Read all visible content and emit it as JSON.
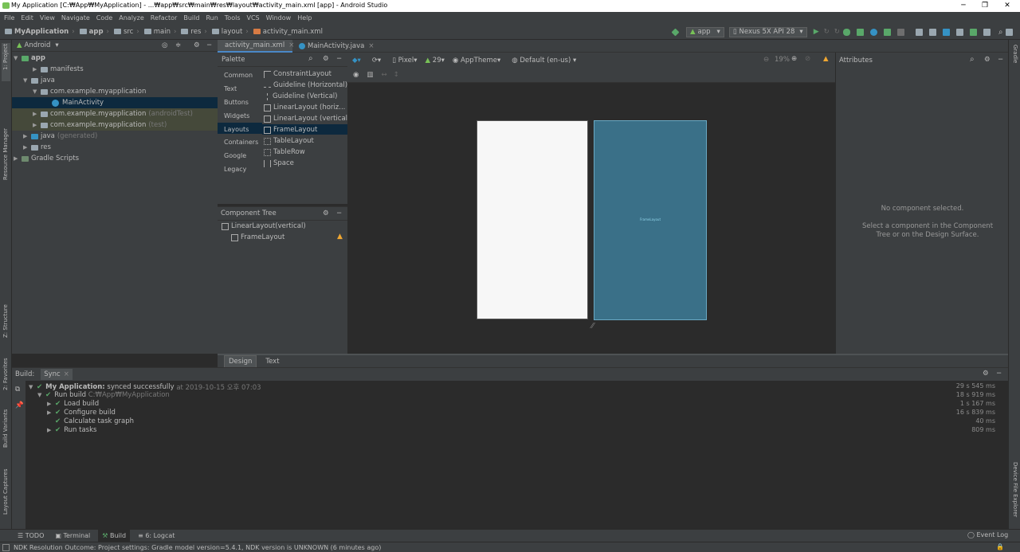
{
  "window": {
    "title": "My Application [C:₩App₩MyApplication] - ...₩app₩src₩main₩res₩layout₩activity_main.xml [app] - Android Studio"
  },
  "menu": [
    "File",
    "Edit",
    "View",
    "Navigate",
    "Code",
    "Analyze",
    "Refactor",
    "Build",
    "Run",
    "Tools",
    "VCS",
    "Window",
    "Help"
  ],
  "breadcrumb": [
    "MyApplication",
    "app",
    "src",
    "main",
    "res",
    "layout",
    "activity_main.xml"
  ],
  "toolbar": {
    "run_config": "app",
    "device": "Nexus 5X API 28"
  },
  "left_tools": {
    "project": "1: Project",
    "resource": "Resource Manager",
    "structure": "Z: Structure",
    "favorites": "2: Favorites",
    "variants": "Build Variants",
    "captures": "Layout Captures"
  },
  "right_tools": {
    "gradle": "Gradle",
    "explorer": "Device File Explorer"
  },
  "project": {
    "view": "Android",
    "tree": [
      {
        "label": "app",
        "extra": ""
      },
      {
        "label": "manifests",
        "extra": ""
      },
      {
        "label": "java",
        "extra": ""
      },
      {
        "label": "com.example.myapplication",
        "extra": ""
      },
      {
        "label": "MainActivity",
        "extra": ""
      },
      {
        "label": "com.example.myapplication",
        "extra": "(androidTest)"
      },
      {
        "label": "com.example.myapplication",
        "extra": "(test)"
      },
      {
        "label": "java",
        "extra": "(generated)"
      },
      {
        "label": "res",
        "extra": ""
      },
      {
        "label": "Gradle Scripts",
        "extra": ""
      }
    ]
  },
  "tabs": [
    "activity_main.xml",
    "MainActivity.java"
  ],
  "palette": {
    "title": "Palette",
    "categories": [
      "Common",
      "Text",
      "Buttons",
      "Widgets",
      "Layouts",
      "Containers",
      "Google",
      "Legacy"
    ],
    "items": [
      "ConstraintLayout",
      "Guideline (Horizontal)",
      "Guideline (Vertical)",
      "LinearLayout (horiz...",
      "LinearLayout (vertical)",
      "FrameLayout",
      "TableLayout",
      "TableRow",
      "Space"
    ]
  },
  "design_toolbar": {
    "device": "Pixel",
    "api": "29",
    "theme": "AppTheme",
    "locale": "Default (en-us)",
    "zoom": "19%"
  },
  "component_tree": {
    "title": "Component Tree",
    "root": "LinearLayout(vertical)",
    "child": "FrameLayout"
  },
  "blueprint": {
    "label": "FrameLayout"
  },
  "attributes": {
    "title": "Attributes",
    "empty": "No component selected.",
    "hint": "Select a component in the Component Tree or on the Design Surface."
  },
  "editor_mode_tabs": [
    "Design",
    "Text"
  ],
  "build": {
    "tabs": [
      "Build:",
      "Sync"
    ],
    "lines": [
      {
        "label": "My Application:",
        "text": "synced successfully",
        "extra": "at 2019-10-15 오후 07:03",
        "time": "29 s 545 ms"
      },
      {
        "label": "Run build",
        "text": "",
        "extra": "C:₩App₩MyApplication",
        "time": "18 s 919 ms"
      },
      {
        "label": "Load build",
        "text": "",
        "extra": "",
        "time": "1 s 167 ms"
      },
      {
        "label": "Configure build",
        "text": "",
        "extra": "",
        "time": "16 s 839 ms"
      },
      {
        "label": "Calculate task graph",
        "text": "",
        "extra": "",
        "time": "40 ms"
      },
      {
        "label": "Run tasks",
        "text": "",
        "extra": "",
        "time": "809 ms"
      }
    ]
  },
  "tool_windows": [
    "TODO",
    "Terminal",
    "Build",
    "6: Logcat"
  ],
  "event_log": "Event Log",
  "status": "NDK Resolution Outcome: Project settings: Gradle model version=5.4.1, NDK version is UNKNOWN (6 minutes ago)",
  "colors": {
    "accent": "#4a88c7",
    "selection": "#0d293e",
    "check": "#59a869",
    "blueprint": "#3a7088",
    "warning": "#f0a732"
  }
}
